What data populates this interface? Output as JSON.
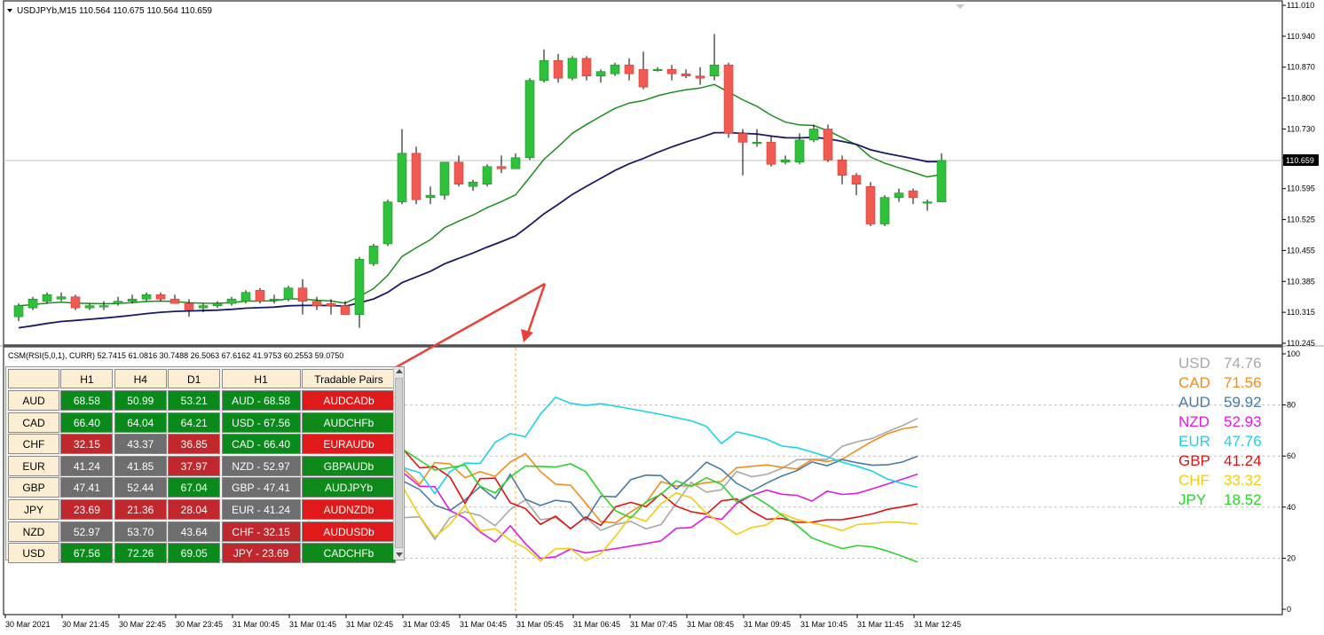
{
  "main_chart": {
    "symbol_info": "USDJPYb,M15  110.564 110.675 110.564 110.659",
    "price_axis": [
      "111.010",
      "110.940",
      "110.870",
      "110.800",
      "110.730",
      "110.665",
      "110.595",
      "110.525",
      "110.455",
      "110.385",
      "110.315",
      "110.245"
    ],
    "current_price": "110.659",
    "candles": [
      [
        110.305,
        110.335,
        110.295,
        110.33
      ],
      [
        110.325,
        110.35,
        110.32,
        110.345
      ],
      [
        110.34,
        110.36,
        110.335,
        110.355
      ],
      [
        110.345,
        110.36,
        110.34,
        110.35
      ],
      [
        110.35,
        110.355,
        110.32,
        110.325
      ],
      [
        110.325,
        110.335,
        110.32,
        110.33
      ],
      [
        110.33,
        110.34,
        110.32,
        110.33
      ],
      [
        110.335,
        110.35,
        110.33,
        110.34
      ],
      [
        110.34,
        110.355,
        110.335,
        110.345
      ],
      [
        110.345,
        110.36,
        110.34,
        110.355
      ],
      [
        110.355,
        110.36,
        110.34,
        110.345
      ],
      [
        110.345,
        110.355,
        110.335,
        110.335
      ],
      [
        110.335,
        110.345,
        110.305,
        110.32
      ],
      [
        110.325,
        110.335,
        110.315,
        110.33
      ],
      [
        110.33,
        110.34,
        110.325,
        110.335
      ],
      [
        110.335,
        110.35,
        110.33,
        110.345
      ],
      [
        110.34,
        110.365,
        110.335,
        110.36
      ],
      [
        110.365,
        110.37,
        110.335,
        110.34
      ],
      [
        110.345,
        110.355,
        110.335,
        110.345
      ],
      [
        110.345,
        110.375,
        110.34,
        110.37
      ],
      [
        110.37,
        110.39,
        110.31,
        110.34
      ],
      [
        110.34,
        110.35,
        110.32,
        110.33
      ],
      [
        110.335,
        110.345,
        110.31,
        110.33
      ],
      [
        110.33,
        110.34,
        110.31,
        110.31
      ],
      [
        110.31,
        110.44,
        110.28,
        110.435
      ],
      [
        110.425,
        110.47,
        110.42,
        110.465
      ],
      [
        110.47,
        110.57,
        110.465,
        110.565
      ],
      [
        110.565,
        110.73,
        110.56,
        110.675
      ],
      [
        110.675,
        110.69,
        110.56,
        110.57
      ],
      [
        110.575,
        110.6,
        110.56,
        110.58
      ],
      [
        110.58,
        110.65,
        110.57,
        110.655
      ],
      [
        110.655,
        110.67,
        110.6,
        110.605
      ],
      [
        110.6,
        110.615,
        110.59,
        110.61
      ],
      [
        110.605,
        110.65,
        110.6,
        110.645
      ],
      [
        110.645,
        110.67,
        110.63,
        110.64
      ],
      [
        110.64,
        110.675,
        110.64,
        110.665
      ],
      [
        110.665,
        110.845,
        110.66,
        110.84
      ],
      [
        110.84,
        110.91,
        110.835,
        110.885
      ],
      [
        110.885,
        110.9,
        110.835,
        110.845
      ],
      [
        110.845,
        110.895,
        110.84,
        110.89
      ],
      [
        110.89,
        110.895,
        110.84,
        110.85
      ],
      [
        110.85,
        110.865,
        110.835,
        110.86
      ],
      [
        110.855,
        110.88,
        110.85,
        110.875
      ],
      [
        110.875,
        110.89,
        110.84,
        110.855
      ],
      [
        110.865,
        110.905,
        110.82,
        110.825
      ],
      [
        110.865,
        110.87,
        110.86,
        110.865
      ],
      [
        110.865,
        110.875,
        110.84,
        110.855
      ],
      [
        110.855,
        110.865,
        110.845,
        110.85
      ],
      [
        110.85,
        110.87,
        110.83,
        110.845
      ],
      [
        110.85,
        110.945,
        110.84,
        110.875
      ],
      [
        110.875,
        110.88,
        110.71,
        110.72
      ],
      [
        110.72,
        110.73,
        110.625,
        110.7
      ],
      [
        110.7,
        110.73,
        110.69,
        110.7
      ],
      [
        110.7,
        110.715,
        110.645,
        110.65
      ],
      [
        110.655,
        110.67,
        110.65,
        110.66
      ],
      [
        110.655,
        110.72,
        110.65,
        110.705
      ],
      [
        110.705,
        110.74,
        110.7,
        110.73
      ],
      [
        110.73,
        110.74,
        110.655,
        110.66
      ],
      [
        110.66,
        110.67,
        110.605,
        110.625
      ],
      [
        110.625,
        110.63,
        110.58,
        110.605
      ],
      [
        110.6,
        110.61,
        110.51,
        110.515
      ],
      [
        110.515,
        110.58,
        110.51,
        110.575
      ],
      [
        110.575,
        110.595,
        110.565,
        110.585
      ],
      [
        110.59,
        110.595,
        110.56,
        110.575
      ],
      [
        110.565,
        110.57,
        110.545,
        110.565
      ],
      [
        110.565,
        110.675,
        110.565,
        110.659
      ]
    ]
  },
  "indicator": {
    "label": "CSM(RSI(5,0,1), CURR) 52.7415 61.0816 30.7488 26.5063 67.6162 41.9753 60.2553 59.0750",
    "axis": [
      "100",
      "80",
      "60",
      "40",
      "20",
      "0"
    ],
    "legend": [
      {
        "name": "USD",
        "value": "74.76",
        "color": "#a8a8a8"
      },
      {
        "name": "CAD",
        "value": "71.56",
        "color": "#f28c1c"
      },
      {
        "name": "AUD",
        "value": "59.92",
        "color": "#4a7aa6"
      },
      {
        "name": "NZD",
        "value": "52.93",
        "color": "#e01ae0"
      },
      {
        "name": "EUR",
        "value": "47.76",
        "color": "#19d4e8"
      },
      {
        "name": "GBP",
        "value": "41.24",
        "color": "#e01010"
      },
      {
        "name": "CHF",
        "value": "33.32",
        "color": "#f2cc10"
      },
      {
        "name": "JPY",
        "value": "18.52",
        "color": "#2ad42a"
      }
    ]
  },
  "table": {
    "headers": [
      "",
      "H1",
      "H4",
      "D1",
      "H1",
      "Tradable Pairs"
    ],
    "rows": [
      {
        "cur": "AUD",
        "h1": "68.58",
        "h4": "50.99",
        "d1": "53.21",
        "rank": "AUD - 68.58",
        "pair": "AUDCADb",
        "c": [
          "g",
          "g",
          "g",
          "g",
          "r"
        ]
      },
      {
        "cur": "CAD",
        "h1": "66.40",
        "h4": "64.04",
        "d1": "64.21",
        "rank": "USD - 67.56",
        "pair": "AUDCHFb",
        "c": [
          "g",
          "g",
          "g",
          "g",
          "g"
        ]
      },
      {
        "cur": "CHF",
        "h1": "32.15",
        "h4": "43.37",
        "d1": "36.85",
        "rank": "CAD - 66.40",
        "pair": "EURAUDb",
        "c": [
          "r",
          "y",
          "r",
          "g",
          "r"
        ]
      },
      {
        "cur": "EUR",
        "h1": "41.24",
        "h4": "41.85",
        "d1": "37.97",
        "rank": "NZD - 52.97",
        "pair": "GBPAUDb",
        "c": [
          "y",
          "y",
          "r",
          "y",
          "g"
        ]
      },
      {
        "cur": "GBP",
        "h1": "47.41",
        "h4": "52.44",
        "d1": "67.04",
        "rank": "GBP - 47.41",
        "pair": "AUDJPYb",
        "c": [
          "y",
          "y",
          "g",
          "y",
          "g"
        ]
      },
      {
        "cur": "JPY",
        "h1": "23.69",
        "h4": "21.36",
        "d1": "28.04",
        "rank": "EUR - 41.24",
        "pair": "AUDNZDb",
        "c": [
          "r",
          "r",
          "r",
          "y",
          "r"
        ]
      },
      {
        "cur": "NZD",
        "h1": "52.97",
        "h4": "53.70",
        "d1": "43.64",
        "rank": "CHF - 32.15",
        "pair": "AUDUSDb",
        "c": [
          "y",
          "y",
          "y",
          "r",
          "r"
        ]
      },
      {
        "cur": "USD",
        "h1": "67.56",
        "h4": "72.26",
        "d1": "69.05",
        "rank": "JPY - 23.69",
        "pair": "CADCHFb",
        "c": [
          "g",
          "g",
          "g",
          "r",
          "g"
        ]
      }
    ]
  },
  "time_axis": [
    "30 Mar 2021",
    "30 Mar 21:45",
    "30 Mar 22:45",
    "30 Mar 23:45",
    "31 Mar 00:45",
    "31 Mar 01:45",
    "31 Mar 02:45",
    "31 Mar 03:45",
    "31 Mar 04:45",
    "31 Mar 05:45",
    "31 Mar 06:45",
    "31 Mar 07:45",
    "31 Mar 08:45",
    "31 Mar 09:45",
    "31 Mar 10:45",
    "31 Mar 11:45",
    "31 Mar 12:45"
  ],
  "colors": {
    "bull": "#2ec23a",
    "bear": "#f05a50",
    "ma_fast": "#1e8c1e",
    "ma_slow": "#1a1a66",
    "cell_green": "#0a8a1a",
    "cell_red": "#c0282e",
    "cell_gray": "#6e6e6e",
    "pair_red": "#e01a1a",
    "pair_green": "#0e8a1a",
    "arrow": "#e8413c"
  }
}
